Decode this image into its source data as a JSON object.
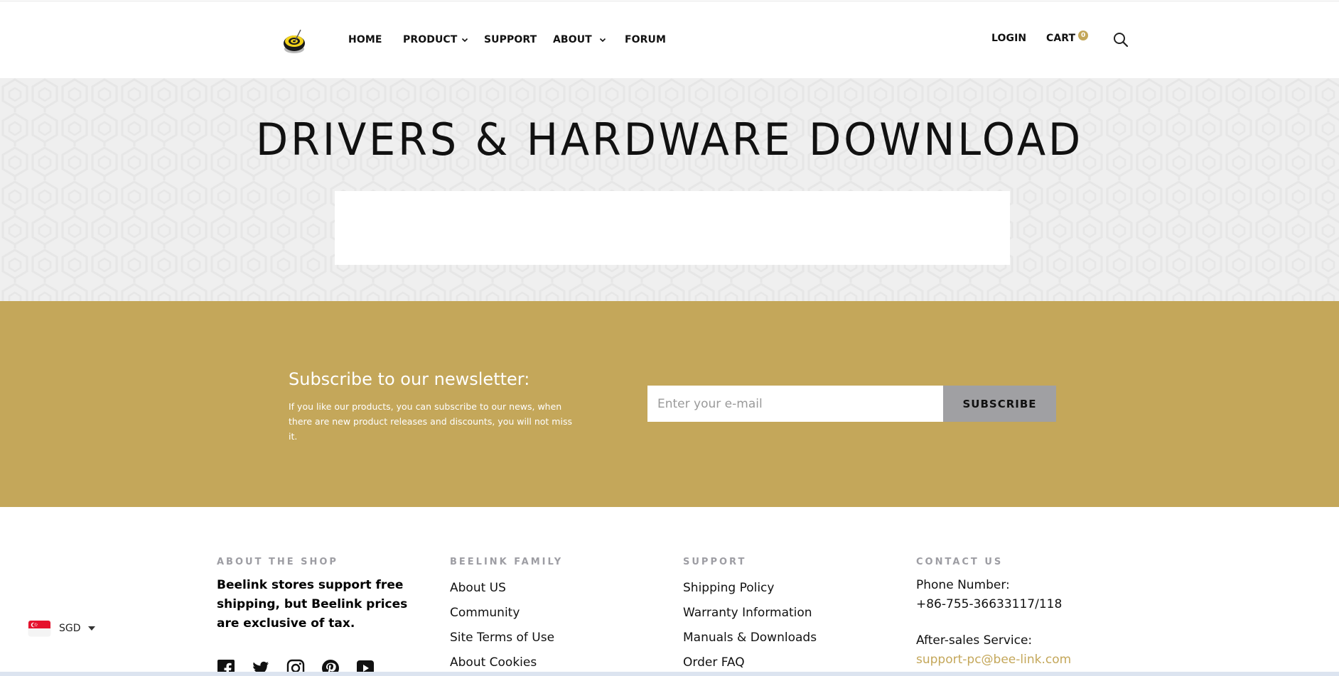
{
  "header": {
    "logo_alt": "Beelink",
    "nav": [
      {
        "label": "HOME",
        "has_dropdown": false
      },
      {
        "label": "PRODUCT",
        "has_dropdown": true
      },
      {
        "label": "SUPPORT",
        "has_dropdown": false
      },
      {
        "label": "ABOUT",
        "has_dropdown": true
      },
      {
        "label": "FORUM",
        "has_dropdown": false
      }
    ],
    "login_label": "LOGIN",
    "cart_label": "CART",
    "cart_count": "0",
    "search_icon": "search-icon"
  },
  "hero": {
    "title": "DRIVERS & HARDWARE DOWNLOAD"
  },
  "newsletter": {
    "title": "Subscribe to our newsletter:",
    "description": "If you like our products, you can subscribe to our news, when there are new product releases and discounts, you will not miss it.",
    "email_placeholder": "Enter your e-mail",
    "email_value": "",
    "subscribe_label": "SUBSCRIBE"
  },
  "footer": {
    "about": {
      "heading": "ABOUT THE SHOP",
      "text": "Beelink stores support free shipping, but Beelink prices are exclusive of tax."
    },
    "family": {
      "heading": "BEELINK FAMILY",
      "links": [
        "About US",
        "Community",
        "Site Terms of Use",
        "About Cookies"
      ]
    },
    "support": {
      "heading": "SUPPORT",
      "links": [
        "Shipping Policy",
        "Warranty Information",
        "Manuals & Downloads",
        "Order FAQ"
      ]
    },
    "contact": {
      "heading": "CONTACT US",
      "phone_label": "Phone Number:",
      "phone": "+86-755-36633117/118",
      "aftersales_label": "After-sales Service:",
      "email": "support-pc@bee-link.com"
    },
    "socials": [
      "facebook-icon",
      "twitter-icon",
      "instagram-icon",
      "pinterest-icon",
      "youtube-icon"
    ]
  },
  "currency": {
    "code": "SGD",
    "flag": "singapore-flag-icon"
  },
  "colors": {
    "accent_gold": "#c4a75a",
    "button_gray": "#a0a0a3",
    "hero_bg": "#efefef",
    "heading_gray": "#9d9da3"
  }
}
